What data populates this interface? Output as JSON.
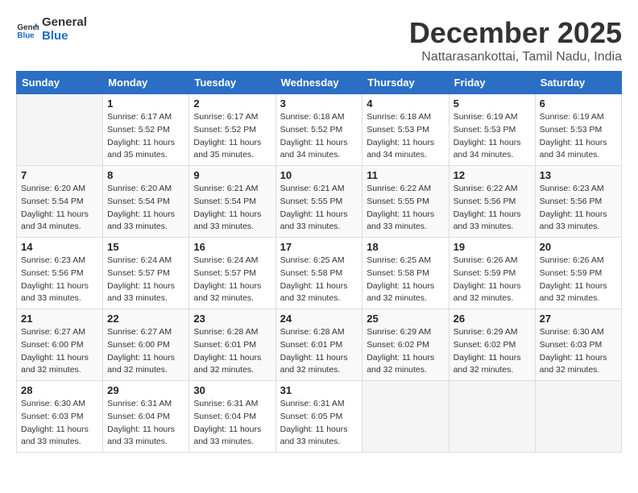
{
  "header": {
    "logo_line1": "General",
    "logo_line2": "Blue",
    "month": "December 2025",
    "location": "Nattarasankottai, Tamil Nadu, India"
  },
  "days_of_week": [
    "Sunday",
    "Monday",
    "Tuesday",
    "Wednesday",
    "Thursday",
    "Friday",
    "Saturday"
  ],
  "weeks": [
    [
      {
        "day": "",
        "sunrise": "",
        "sunset": "",
        "daylight": ""
      },
      {
        "day": "1",
        "sunrise": "Sunrise: 6:17 AM",
        "sunset": "Sunset: 5:52 PM",
        "daylight": "Daylight: 11 hours and 35 minutes."
      },
      {
        "day": "2",
        "sunrise": "Sunrise: 6:17 AM",
        "sunset": "Sunset: 5:52 PM",
        "daylight": "Daylight: 11 hours and 35 minutes."
      },
      {
        "day": "3",
        "sunrise": "Sunrise: 6:18 AM",
        "sunset": "Sunset: 5:52 PM",
        "daylight": "Daylight: 11 hours and 34 minutes."
      },
      {
        "day": "4",
        "sunrise": "Sunrise: 6:18 AM",
        "sunset": "Sunset: 5:53 PM",
        "daylight": "Daylight: 11 hours and 34 minutes."
      },
      {
        "day": "5",
        "sunrise": "Sunrise: 6:19 AM",
        "sunset": "Sunset: 5:53 PM",
        "daylight": "Daylight: 11 hours and 34 minutes."
      },
      {
        "day": "6",
        "sunrise": "Sunrise: 6:19 AM",
        "sunset": "Sunset: 5:53 PM",
        "daylight": "Daylight: 11 hours and 34 minutes."
      }
    ],
    [
      {
        "day": "7",
        "sunrise": "Sunrise: 6:20 AM",
        "sunset": "Sunset: 5:54 PM",
        "daylight": "Daylight: 11 hours and 34 minutes."
      },
      {
        "day": "8",
        "sunrise": "Sunrise: 6:20 AM",
        "sunset": "Sunset: 5:54 PM",
        "daylight": "Daylight: 11 hours and 33 minutes."
      },
      {
        "day": "9",
        "sunrise": "Sunrise: 6:21 AM",
        "sunset": "Sunset: 5:54 PM",
        "daylight": "Daylight: 11 hours and 33 minutes."
      },
      {
        "day": "10",
        "sunrise": "Sunrise: 6:21 AM",
        "sunset": "Sunset: 5:55 PM",
        "daylight": "Daylight: 11 hours and 33 minutes."
      },
      {
        "day": "11",
        "sunrise": "Sunrise: 6:22 AM",
        "sunset": "Sunset: 5:55 PM",
        "daylight": "Daylight: 11 hours and 33 minutes."
      },
      {
        "day": "12",
        "sunrise": "Sunrise: 6:22 AM",
        "sunset": "Sunset: 5:56 PM",
        "daylight": "Daylight: 11 hours and 33 minutes."
      },
      {
        "day": "13",
        "sunrise": "Sunrise: 6:23 AM",
        "sunset": "Sunset: 5:56 PM",
        "daylight": "Daylight: 11 hours and 33 minutes."
      }
    ],
    [
      {
        "day": "14",
        "sunrise": "Sunrise: 6:23 AM",
        "sunset": "Sunset: 5:56 PM",
        "daylight": "Daylight: 11 hours and 33 minutes."
      },
      {
        "day": "15",
        "sunrise": "Sunrise: 6:24 AM",
        "sunset": "Sunset: 5:57 PM",
        "daylight": "Daylight: 11 hours and 33 minutes."
      },
      {
        "day": "16",
        "sunrise": "Sunrise: 6:24 AM",
        "sunset": "Sunset: 5:57 PM",
        "daylight": "Daylight: 11 hours and 32 minutes."
      },
      {
        "day": "17",
        "sunrise": "Sunrise: 6:25 AM",
        "sunset": "Sunset: 5:58 PM",
        "daylight": "Daylight: 11 hours and 32 minutes."
      },
      {
        "day": "18",
        "sunrise": "Sunrise: 6:25 AM",
        "sunset": "Sunset: 5:58 PM",
        "daylight": "Daylight: 11 hours and 32 minutes."
      },
      {
        "day": "19",
        "sunrise": "Sunrise: 6:26 AM",
        "sunset": "Sunset: 5:59 PM",
        "daylight": "Daylight: 11 hours and 32 minutes."
      },
      {
        "day": "20",
        "sunrise": "Sunrise: 6:26 AM",
        "sunset": "Sunset: 5:59 PM",
        "daylight": "Daylight: 11 hours and 32 minutes."
      }
    ],
    [
      {
        "day": "21",
        "sunrise": "Sunrise: 6:27 AM",
        "sunset": "Sunset: 6:00 PM",
        "daylight": "Daylight: 11 hours and 32 minutes."
      },
      {
        "day": "22",
        "sunrise": "Sunrise: 6:27 AM",
        "sunset": "Sunset: 6:00 PM",
        "daylight": "Daylight: 11 hours and 32 minutes."
      },
      {
        "day": "23",
        "sunrise": "Sunrise: 6:28 AM",
        "sunset": "Sunset: 6:01 PM",
        "daylight": "Daylight: 11 hours and 32 minutes."
      },
      {
        "day": "24",
        "sunrise": "Sunrise: 6:28 AM",
        "sunset": "Sunset: 6:01 PM",
        "daylight": "Daylight: 11 hours and 32 minutes."
      },
      {
        "day": "25",
        "sunrise": "Sunrise: 6:29 AM",
        "sunset": "Sunset: 6:02 PM",
        "daylight": "Daylight: 11 hours and 32 minutes."
      },
      {
        "day": "26",
        "sunrise": "Sunrise: 6:29 AM",
        "sunset": "Sunset: 6:02 PM",
        "daylight": "Daylight: 11 hours and 32 minutes."
      },
      {
        "day": "27",
        "sunrise": "Sunrise: 6:30 AM",
        "sunset": "Sunset: 6:03 PM",
        "daylight": "Daylight: 11 hours and 32 minutes."
      }
    ],
    [
      {
        "day": "28",
        "sunrise": "Sunrise: 6:30 AM",
        "sunset": "Sunset: 6:03 PM",
        "daylight": "Daylight: 11 hours and 33 minutes."
      },
      {
        "day": "29",
        "sunrise": "Sunrise: 6:31 AM",
        "sunset": "Sunset: 6:04 PM",
        "daylight": "Daylight: 11 hours and 33 minutes."
      },
      {
        "day": "30",
        "sunrise": "Sunrise: 6:31 AM",
        "sunset": "Sunset: 6:04 PM",
        "daylight": "Daylight: 11 hours and 33 minutes."
      },
      {
        "day": "31",
        "sunrise": "Sunrise: 6:31 AM",
        "sunset": "Sunset: 6:05 PM",
        "daylight": "Daylight: 11 hours and 33 minutes."
      },
      {
        "day": "",
        "sunrise": "",
        "sunset": "",
        "daylight": ""
      },
      {
        "day": "",
        "sunrise": "",
        "sunset": "",
        "daylight": ""
      },
      {
        "day": "",
        "sunrise": "",
        "sunset": "",
        "daylight": ""
      }
    ]
  ]
}
